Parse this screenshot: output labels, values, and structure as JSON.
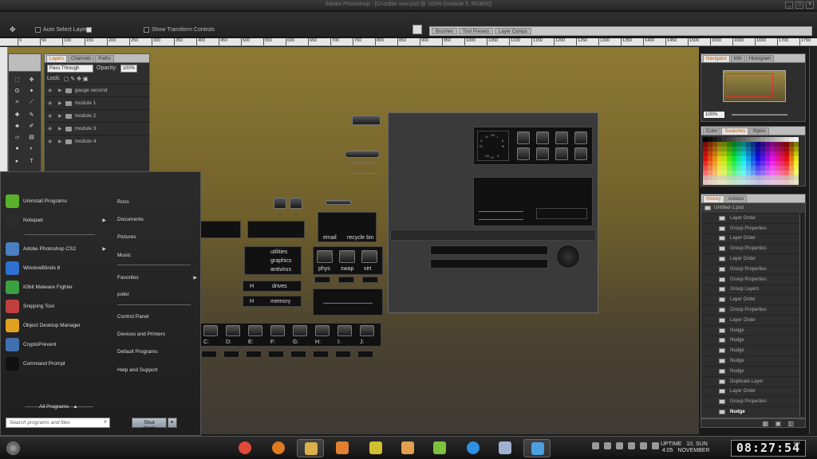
{
  "window": {
    "title": "Adobe Photoshop - [Crucible new.psd @ 100% (module 5, RGB/8)]"
  },
  "options_bar": {
    "auto_select_label": "Auto Select Layer",
    "show_transform_label": "Show Transform Controls",
    "well_tabs": [
      "Brushes",
      "Tool Presets",
      "Layer Comps"
    ]
  },
  "ruler": {
    "ticks": [
      "0",
      "50",
      "100",
      "150",
      "200",
      "250",
      "300",
      "350",
      "400",
      "450",
      "500",
      "550",
      "600",
      "650",
      "700",
      "750",
      "800",
      "850",
      "900",
      "950",
      "1000",
      "1050",
      "1100",
      "1150",
      "1200",
      "1250",
      "1300",
      "1350",
      "1400",
      "1450",
      "1500",
      "1550",
      "1600",
      "1650",
      "1700",
      "1750"
    ]
  },
  "layers_panel": {
    "tabs": [
      "Layers",
      "Channels",
      "Paths"
    ],
    "blend_mode": "Pass Through",
    "opacity_label": "Opacity:",
    "opacity_value": "100%",
    "lock_label": "Lock:",
    "layers": [
      "gauge second",
      "module 1",
      "module 2",
      "module 3",
      "module 4"
    ]
  },
  "start_menu": {
    "left_items": [
      {
        "label": "Uninstall Programs",
        "icon": "uninstall-icon",
        "color": "#5ab02a",
        "arrow": false
      },
      {
        "label": "Notepad",
        "icon": "notepad-icon",
        "color": "#2c2c2c",
        "arrow": true
      },
      {
        "label": "Adobe Photoshop CS2",
        "icon": "photoshop-icon",
        "color": "#4a7fc0",
        "arrow": true
      },
      {
        "label": "WindowBlinds 8",
        "icon": "windowblinds-icon",
        "color": "#3070d0",
        "arrow": false
      },
      {
        "label": "IObit Malware Fighter",
        "icon": "malware-fighter-icon",
        "color": "#3aa040",
        "arrow": false
      },
      {
        "label": "Snipping Tool",
        "icon": "snipping-tool-icon",
        "color": "#c04040",
        "arrow": false
      },
      {
        "label": "Object Desktop Manager",
        "icon": "object-desktop-icon",
        "color": "#e0a020",
        "arrow": false
      },
      {
        "label": "CryptoPrevent",
        "icon": "cryptoprevent-icon",
        "color": "#4070b0",
        "arrow": false
      },
      {
        "label": "Command Prompt",
        "icon": "command-prompt-icon",
        "color": "#111111",
        "arrow": false
      }
    ],
    "all_programs": "All Programs",
    "right_items": [
      "Ross",
      "Documents",
      "Pictures",
      "Music",
      "Favorites",
      "puter",
      "Control Panel",
      "Devices and Printers",
      "Default Programs",
      "Help and Support"
    ],
    "search_placeholder": "Search programs and files",
    "shutdown_label": "Shut down"
  },
  "canvas": {
    "labels": {
      "email": "email",
      "recycle": "recycle bin",
      "utilities": "utilities",
      "graphics": "graphics",
      "antivirus": "antivirus",
      "drives": "drives",
      "memory": "memory",
      "phys": "phys",
      "swap": "swap",
      "virt": "virt",
      "h1": "H",
      "h2": "H"
    },
    "drive_letters": [
      "C:",
      "D:",
      "E:",
      "F:",
      "G:",
      "H:",
      "I:",
      "J:"
    ],
    "top_row_h": [
      "H",
      "H",
      "H"
    ],
    "clock_numbers": [
      "XII",
      "III",
      "VI",
      "IX",
      "XI",
      "I",
      "X",
      "II",
      "VII",
      "V"
    ]
  },
  "navigator": {
    "tabs": [
      "Navigator",
      "Info",
      "Histogram"
    ],
    "zoom": "100%"
  },
  "swatches": {
    "tabs": [
      "Color",
      "Swatches",
      "Styles"
    ]
  },
  "history": {
    "tabs": [
      "History",
      "Actions"
    ],
    "snapshot": "Untitled-1.psd",
    "items": [
      "Layer Order",
      "Group Properties",
      "Layer Order",
      "Group Properties",
      "Layer Order",
      "Group Properties",
      "Group Properties",
      "Group Layers",
      "Layer Order",
      "Group Properties",
      "Layer Order",
      "Nudge",
      "Nudge",
      "Nudge",
      "Nudge",
      "Nudge",
      "Duplicate Layer",
      "Layer Order",
      "Group Properties",
      "Nudge"
    ],
    "active_index": 19
  },
  "taskbar": {
    "apps": [
      {
        "name": "chrome",
        "color": "#e04a3a"
      },
      {
        "name": "firefox",
        "color": "#e07a20"
      },
      {
        "name": "file-explorer",
        "color": "#d9b04a"
      },
      {
        "name": "media-player",
        "color": "#e08030"
      },
      {
        "name": "xmind",
        "color": "#d0c030"
      },
      {
        "name": "bug-app",
        "color": "#e0a050"
      },
      {
        "name": "notepad-plus",
        "color": "#80c040"
      },
      {
        "name": "ccleaner",
        "color": "#3090e0"
      },
      {
        "name": "document-app",
        "color": "#a0b0d0"
      },
      {
        "name": "photoshop",
        "color": "#4aa0e0"
      }
    ],
    "uptime_label": "UPTIME",
    "uptime_value": "4:05",
    "date_line1": "10, SUN",
    "date_line2": "NOVEMBER",
    "clock": "08:27:54",
    "ampm": "PM"
  }
}
